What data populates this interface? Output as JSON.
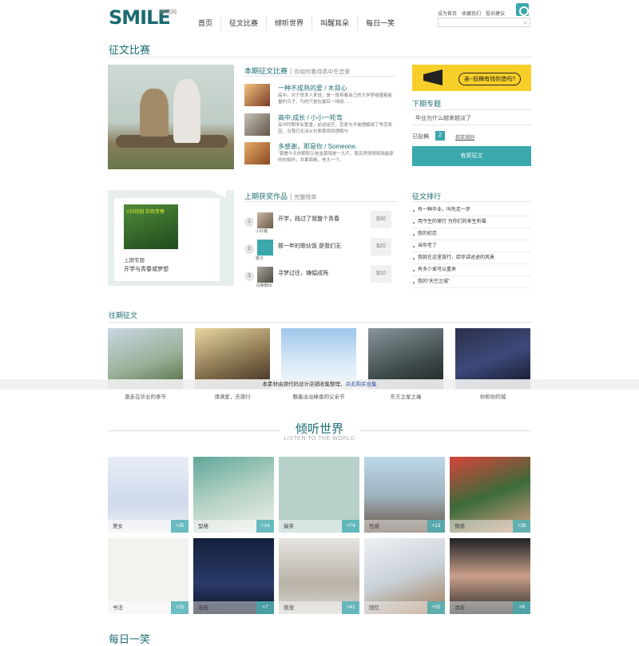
{
  "header": {
    "logo_text": "SMILE",
    "logo_sub": "微笑网",
    "nav": [
      "首页",
      "征文比赛",
      "倾听世界",
      "叫醒耳朵",
      "每日一笑"
    ],
    "links": [
      "设为首页",
      "收藏我们",
      "投诉建议"
    ]
  },
  "page_title": "征文比赛",
  "current": {
    "title": "本期征文比赛",
    "subtitle": "你如何看待高中生恋爱",
    "stories": [
      {
        "title": "一种不成熟的爱 / 木目心",
        "desc": "高中。对于很多人来说，是一段带着自己的大学梦碰撞着能量的日子，为的只是在最后一场战……"
      },
      {
        "title": "高中,成长 / 小小一轮弯",
        "desc": "高中时期学业繁重，前途迷茫，恋爱与不被理解成了早恋原因，当我们无法从长辈那得到理解与"
      },
      {
        "title": "多感谢，那是你 / Someone.",
        "desc": "“慕眷今天的朝阳又是金黄哦是一大片，我突然很想和晓能家的你相伴，并果面嘛，老大一个。"
      }
    ]
  },
  "sidebar": {
    "ad_text": "亲~投稿有钱你造吗?",
    "next_title": "下期专题",
    "next_topic": "毕业为什么越来越淡了",
    "submitted_label": "已投稿",
    "submitted_count": "2",
    "rules_link": "获奖规则",
    "submit_button": "有奖征文"
  },
  "last": {
    "title": "上期获奖作品",
    "full_list": "完整榜单",
    "cover_text": "0日校园 实践青春",
    "label": "上期专题",
    "topic": "开学与青春或梦想",
    "awards": [
      {
        "no": "1",
        "title": "开学，践过了我整个青春",
        "author": "小红猪",
        "prize": "$30"
      },
      {
        "no": "2",
        "title": "那一年的歌伙饭 是我们无",
        "author": "瓊子",
        "prize": "$20"
      },
      {
        "no": "3",
        "title": "寻梦过往，铸幅成殇",
        "author": "马琳珊55",
        "prize": "$10"
      }
    ]
  },
  "ranking": {
    "title": "征文排行",
    "items": [
      "有一种毕业，叫先走一步",
      "用今生的律行 为你们的来生祈福",
      "我的初恋",
      "当你老了",
      "我就在这里旅行，给你讲述途的风景",
      "有多少爱可以重来",
      "我的“天空之城”"
    ]
  },
  "past": {
    "title": "往期征文",
    "captions": [
      "激走在毕业的季节",
      "请满爱，去旅行",
      "飘着淡淡樟香的父亲节",
      "东方之星之痛",
      "你和你的城"
    ]
  },
  "notice": {
    "text": "本素材由源代码设计店铺收集整理，",
    "link": "点此购买合集"
  },
  "listen": {
    "title": "倾听世界",
    "subtitle": "LISTEN TO THE WORLD",
    "tiles": [
      {
        "tag": "美女",
        "count": "+35"
      },
      {
        "tag": "型格",
        "count": "+14"
      },
      {
        "tag": "搞笑",
        "count": "+74"
      },
      {
        "tag": "性感",
        "count": "+13"
      },
      {
        "tag": "情感",
        "count": "+38"
      },
      {
        "tag": "书法",
        "count": "+25"
      },
      {
        "tag": "漫画",
        "count": "+7"
      },
      {
        "tag": "萌宠",
        "count": "+41"
      },
      {
        "tag": "回忆",
        "count": "+55"
      },
      {
        "tag": "清新",
        "count": "+8"
      }
    ]
  },
  "bottom_title": "每日一笑"
}
